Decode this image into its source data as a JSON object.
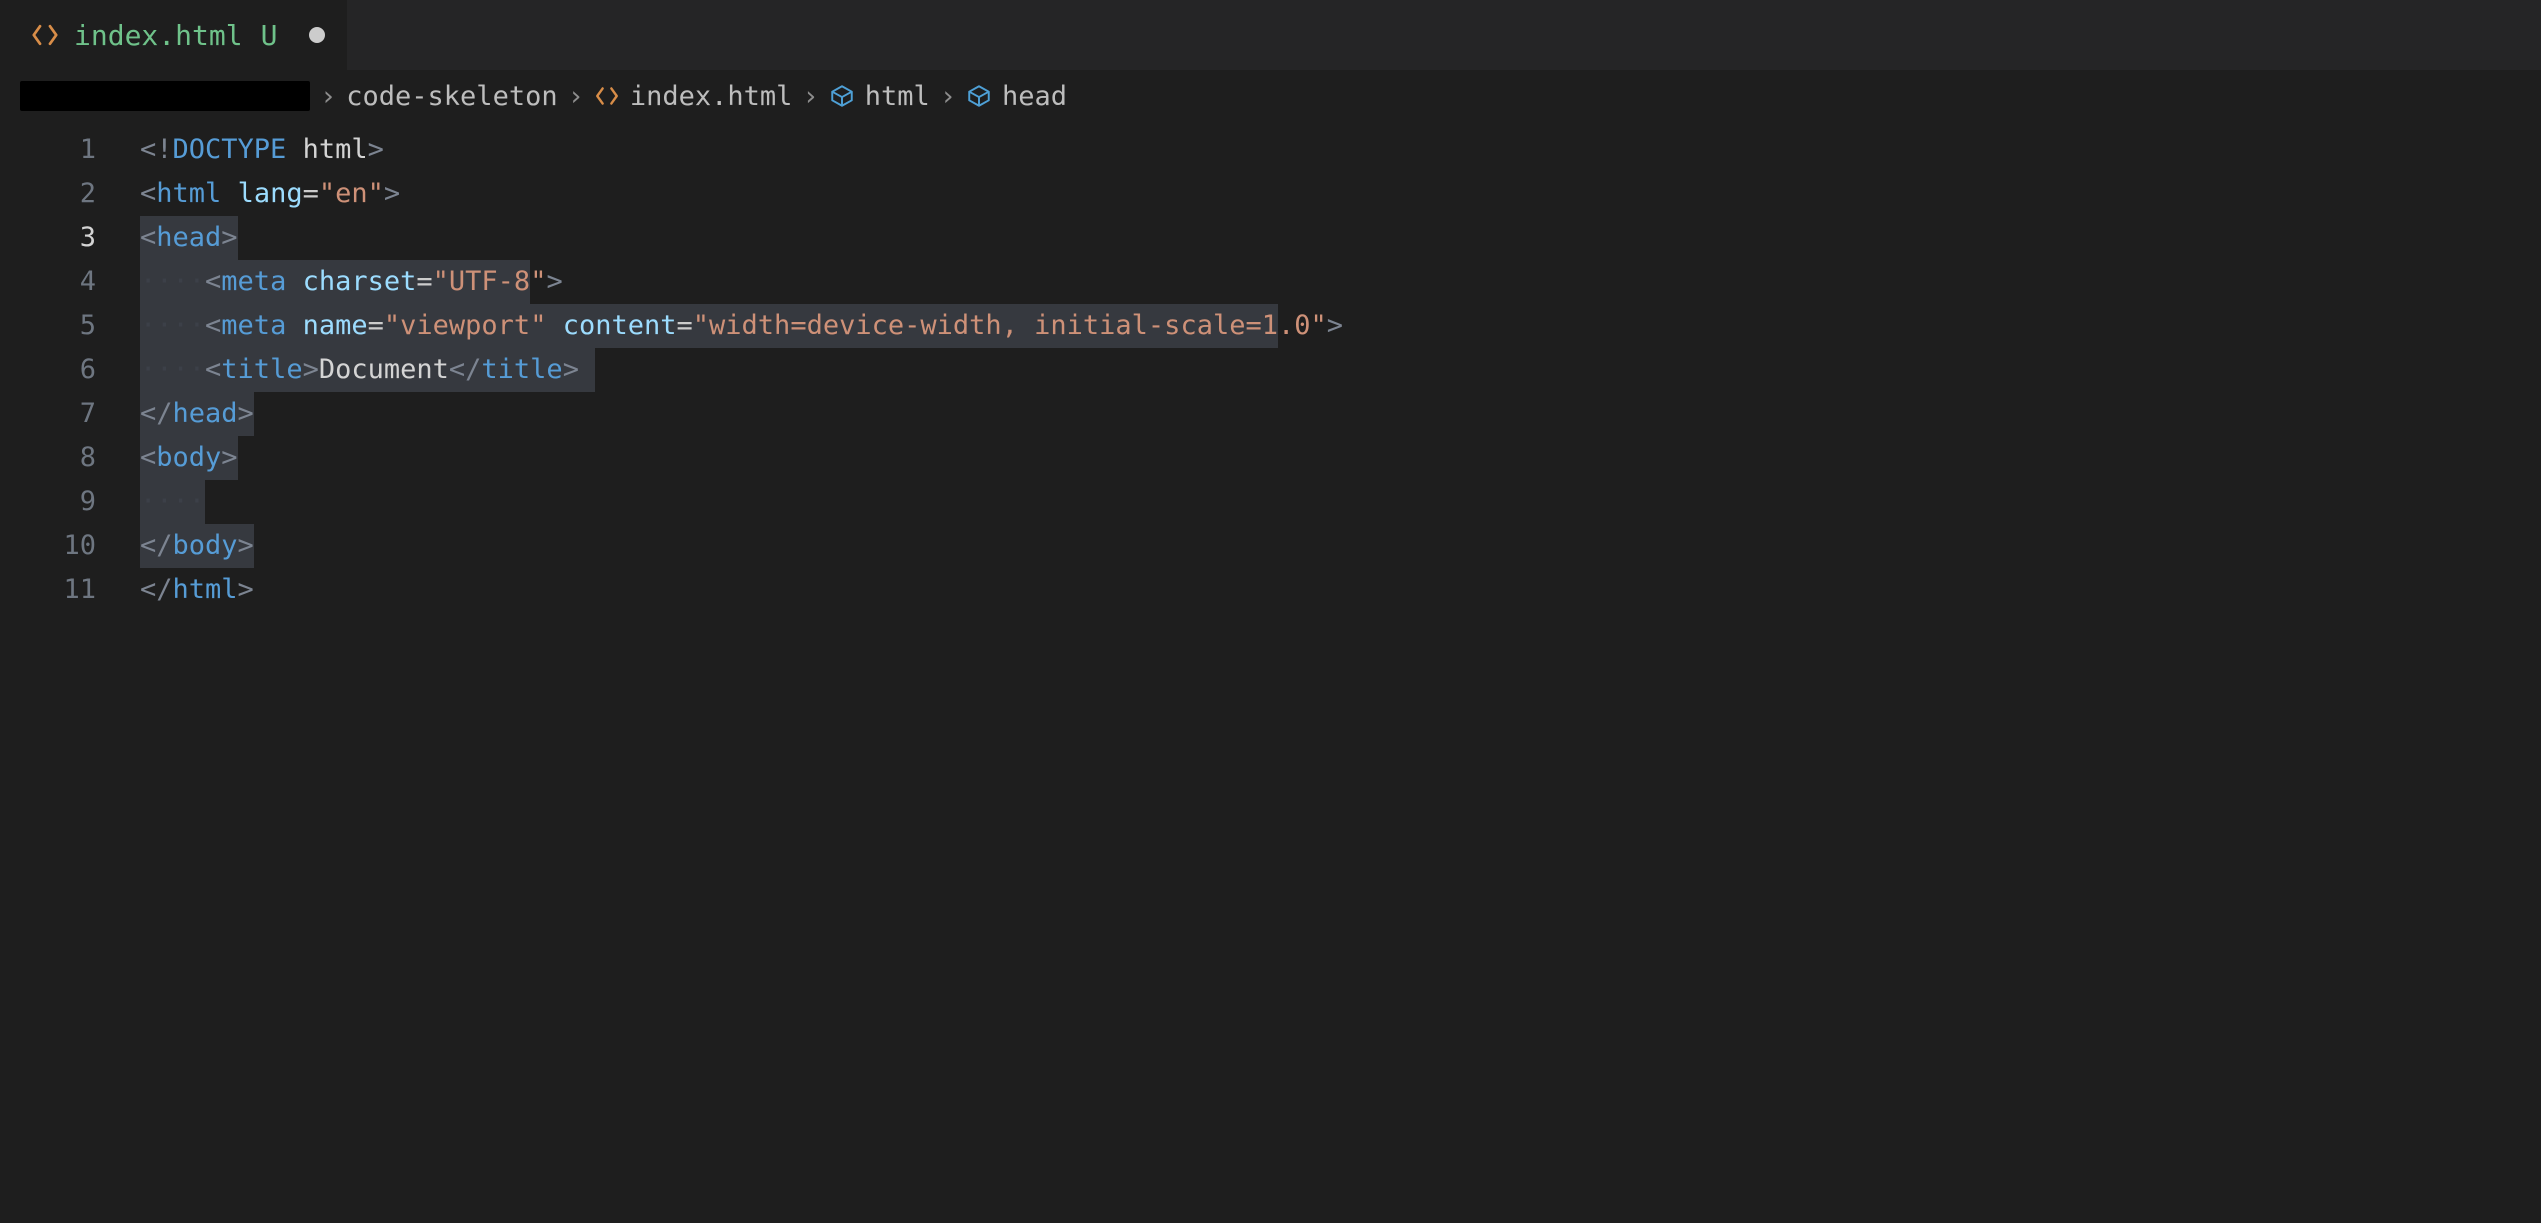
{
  "tab": {
    "filename": "index.html",
    "git_status": "U",
    "dirty": true
  },
  "breadcrumbs": {
    "items": [
      {
        "kind": "redacted"
      },
      {
        "kind": "folder",
        "label": "code-skeleton"
      },
      {
        "kind": "file",
        "label": "index.html"
      },
      {
        "kind": "symbol",
        "label": "html"
      },
      {
        "kind": "symbol",
        "label": "head"
      }
    ]
  },
  "chev": "›",
  "editor": {
    "active_line": 3,
    "line_numbers": [
      "1",
      "2",
      "3",
      "4",
      "5",
      "6",
      "7",
      "8",
      "9",
      "10",
      "11"
    ],
    "lines": [
      [
        {
          "c": "tk-punc",
          "t": "<!"
        },
        {
          "c": "tk-doct",
          "t": "DOCTYPE"
        },
        {
          "c": "tk-punc",
          "t": " "
        },
        {
          "c": "tk-dockw",
          "t": "html"
        },
        {
          "c": "tk-punc",
          "t": ">"
        }
      ],
      [
        {
          "c": "tk-punc",
          "t": "<"
        },
        {
          "c": "tk-tag",
          "t": "html"
        },
        {
          "c": "tk-punc",
          "t": " "
        },
        {
          "c": "tk-attr",
          "t": "lang"
        },
        {
          "c": "tk-eq",
          "t": "="
        },
        {
          "c": "tk-str",
          "t": "\"en\""
        },
        {
          "c": "tk-punc",
          "t": ">"
        }
      ],
      [
        {
          "c": "tk-punc",
          "t": "<"
        },
        {
          "c": "tk-tag",
          "t": "head"
        },
        {
          "c": "tk-punc",
          "t": ">"
        }
      ],
      [
        {
          "c": "tk-ws",
          "t": "····"
        },
        {
          "c": "tk-punc",
          "t": "<"
        },
        {
          "c": "tk-tag",
          "t": "meta"
        },
        {
          "c": "tk-punc",
          "t": " "
        },
        {
          "c": "tk-attr",
          "t": "charset"
        },
        {
          "c": "tk-eq",
          "t": "="
        },
        {
          "c": "tk-str",
          "t": "\"UTF-8\""
        },
        {
          "c": "tk-punc",
          "t": ">"
        }
      ],
      [
        {
          "c": "tk-ws",
          "t": "····"
        },
        {
          "c": "tk-punc",
          "t": "<"
        },
        {
          "c": "tk-tag",
          "t": "meta"
        },
        {
          "c": "tk-punc",
          "t": " "
        },
        {
          "c": "tk-attr",
          "t": "name"
        },
        {
          "c": "tk-eq",
          "t": "="
        },
        {
          "c": "tk-str",
          "t": "\"viewport\""
        },
        {
          "c": "tk-punc",
          "t": " "
        },
        {
          "c": "tk-attr",
          "t": "content"
        },
        {
          "c": "tk-eq",
          "t": "="
        },
        {
          "c": "tk-str",
          "t": "\"width=device-width, initial-scale=1.0\""
        },
        {
          "c": "tk-punc",
          "t": ">"
        }
      ],
      [
        {
          "c": "tk-ws",
          "t": "····"
        },
        {
          "c": "tk-punc",
          "t": "<"
        },
        {
          "c": "tk-tag",
          "t": "title"
        },
        {
          "c": "tk-punc",
          "t": ">"
        },
        {
          "c": "tk-text",
          "t": "Document"
        },
        {
          "c": "tk-punc",
          "t": "</"
        },
        {
          "c": "tk-tag",
          "t": "title"
        },
        {
          "c": "tk-punc",
          "t": ">"
        }
      ],
      [
        {
          "c": "tk-punc",
          "t": "</"
        },
        {
          "c": "tk-tag",
          "t": "head"
        },
        {
          "c": "tk-punc",
          "t": ">"
        }
      ],
      [
        {
          "c": "tk-punc",
          "t": "<"
        },
        {
          "c": "tk-tag",
          "t": "body"
        },
        {
          "c": "tk-punc",
          "t": ">"
        }
      ],
      [
        {
          "c": "tk-ws",
          "t": "····"
        }
      ],
      [
        {
          "c": "tk-punc",
          "t": "</"
        },
        {
          "c": "tk-tag",
          "t": "body"
        },
        {
          "c": "tk-punc",
          "t": ">"
        }
      ],
      [
        {
          "c": "tk-punc",
          "t": "</"
        },
        {
          "c": "tk-tag",
          "t": "html"
        },
        {
          "c": "tk-punc",
          "t": ">"
        }
      ]
    ],
    "selection_chars": [
      {
        "line": 3,
        "start": 0,
        "end": 6
      },
      {
        "line": 4,
        "start": 0,
        "end": 24
      },
      {
        "line": 5,
        "start": 0,
        "end": 70
      },
      {
        "line": 6,
        "start": 0,
        "end": 28
      },
      {
        "line": 7,
        "start": 0,
        "end": 7
      },
      {
        "line": 8,
        "start": 0,
        "end": 6
      },
      {
        "line": 9,
        "start": 0,
        "end": 4
      },
      {
        "line": 10,
        "start": 0,
        "end": 7
      }
    ]
  }
}
